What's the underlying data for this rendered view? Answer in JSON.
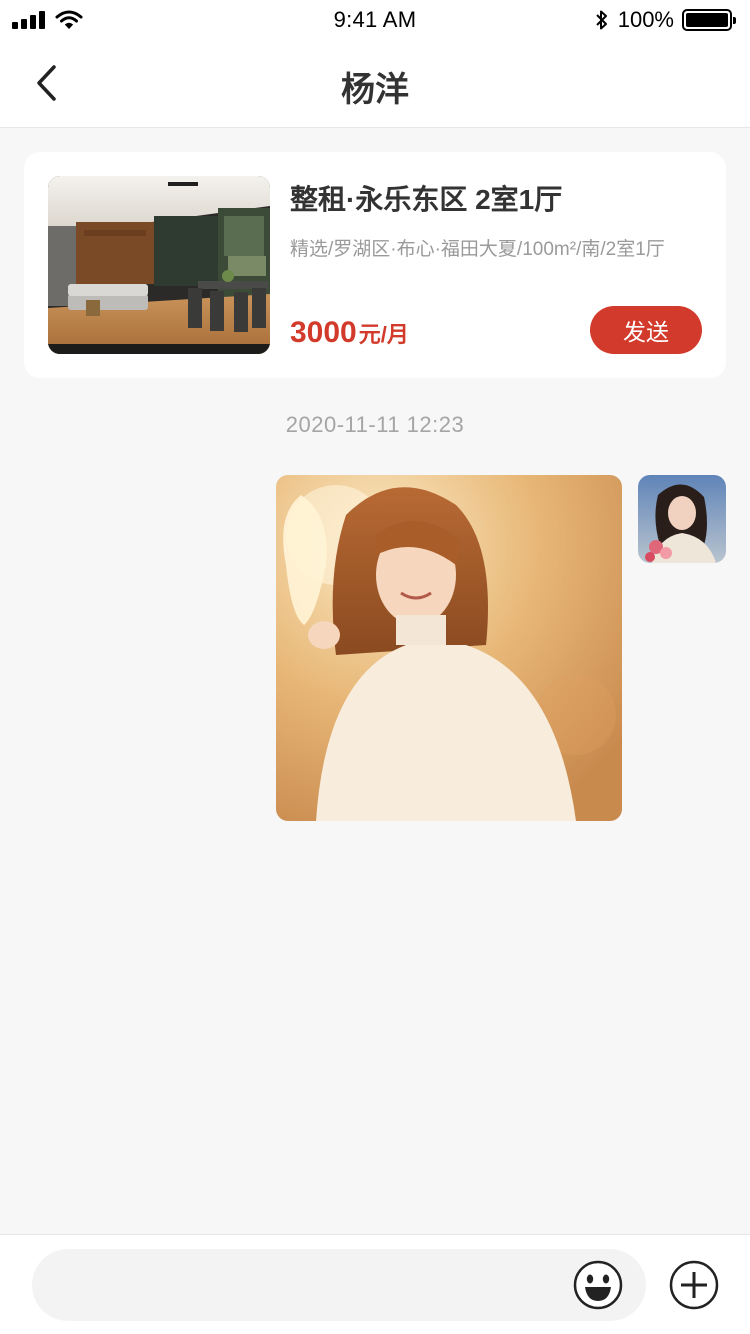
{
  "status_bar": {
    "time": "9:41 AM",
    "battery_text": "100%",
    "icons": [
      "signal-icon",
      "wifi-icon",
      "bluetooth-icon",
      "battery-icon"
    ]
  },
  "nav": {
    "title": "杨洋",
    "back_icon": "chevron-left-icon"
  },
  "house_card": {
    "title": "整租·永乐东区 2室1厅",
    "tags": "精选/罗湖区·布心·福田大夏/100m²/南/2室1厅",
    "price_value": "3000",
    "price_unit": "元/月",
    "send_label": "发送",
    "accent_color": "#d23a2b"
  },
  "chat": {
    "timestamp": "2020-11-11 12:23"
  },
  "input_bar": {
    "placeholder": "",
    "emoji_icon": "smiley-icon",
    "plus_icon": "plus-circle-icon"
  }
}
